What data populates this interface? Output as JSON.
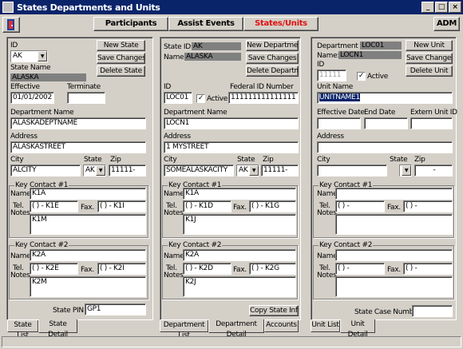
{
  "window": {
    "title": "States Departments and Units"
  },
  "toolbar": {
    "participants": "Participants",
    "assist_events": "Assist Events",
    "states_units": "States/Units",
    "adm": "ADM"
  },
  "state": {
    "id_label": "ID",
    "id_value": "AK",
    "name_label": "State Name",
    "name_value": "ALASKA",
    "effective_label": "Effective",
    "effective_value": "01/01/2002",
    "terminate_label": "Terminate",
    "terminate_value": "",
    "dept_name_label": "Department Name",
    "dept_name_value": "ALASKADEPTNAME",
    "address_label": "Address",
    "address_value": "ALASKASTREET",
    "city_label": "City",
    "city_value": "ALCITY",
    "state_label": "State",
    "state_value": "AK",
    "zip_label": "Zip",
    "zip_value": "11111-",
    "new_btn": "New State",
    "save_btn": "Save Changes",
    "delete_btn": "Delete State",
    "kc1": {
      "title": "Key Contact #1",
      "name": "K1A",
      "tel": "(  )  - K1E",
      "fax": "(  )  - K1I",
      "notes": "K1M"
    },
    "kc2": {
      "title": "Key Contact #2",
      "name": "K2A",
      "tel": "(  )  - K2E",
      "fax": "(  )  - K2I",
      "notes": "K2M"
    },
    "pin_label": "State PIN",
    "pin_value": "GP1",
    "tabs": [
      "State List",
      "State Detail"
    ]
  },
  "dept": {
    "state_id_label": "State ID:",
    "state_id_value": "AK",
    "name_label": "Name:",
    "name_value": "ALASKA",
    "id_label": "ID",
    "id_value": "LOC01",
    "active_label": "Active",
    "fed_label": "Federal ID Number",
    "fed_value": "111111111111111",
    "dept_name_label": "Department Name",
    "dept_name_value": "LOCN1",
    "address_label": "Address",
    "address_value": "1 MYSTREET",
    "city_label": "City",
    "city_value": "SOMEALASKACITY",
    "state_label": "State",
    "state_value": "AK",
    "zip_label": "Zip",
    "zip_value": "11111-",
    "new_btn": "New Department",
    "save_btn": "Save Changes",
    "delete_btn": "Delete Department",
    "kc1": {
      "title": "Key Contact #1",
      "name": "K1A",
      "tel": "(  )  - K1D",
      "fax": "(  )  - K1G",
      "notes": "K1J"
    },
    "kc2": {
      "title": "Key Contact #2",
      "name": "K2A",
      "tel": "(  )  - K2D",
      "fax": "(  )  - K2G",
      "notes": "K2J"
    },
    "copy_btn": "Copy State Info",
    "tabs": [
      "Department List",
      "Department Detail",
      "Accounts"
    ]
  },
  "unit": {
    "dept_id_label": "Department ID:",
    "dept_id_value": "LOC01",
    "name_label": "Name:",
    "name_value": "LOCN1",
    "id_label": "ID",
    "id_value": "11111",
    "active_label": "Active",
    "unit_name_label": "Unit Name",
    "unit_name_value": "UNITNAME1",
    "eff_label": "Effective Date",
    "end_label": "End Date",
    "ext_label": "Extern Unit ID",
    "address_label": "Address",
    "city_label": "City",
    "state_label": "State",
    "zip_label": "Zip",
    "zip_value": "-",
    "new_btn": "New Unit",
    "save_btn": "Save Changes",
    "delete_btn": "Delete Unit",
    "kc1": {
      "title": "Key Contact #1",
      "tel": "(  )  -",
      "fax": "(  )  -"
    },
    "kc2": {
      "title": "Key Contact #2",
      "tel": "(  )  -",
      "fax": "(  )  -"
    },
    "case_label": "State Case Number",
    "tabs": [
      "Unit List",
      "Unit Detail"
    ]
  },
  "common": {
    "name_label": "Name",
    "tel_label": "Tel.",
    "notes_label": "Notes",
    "fax_label": "Fax."
  }
}
